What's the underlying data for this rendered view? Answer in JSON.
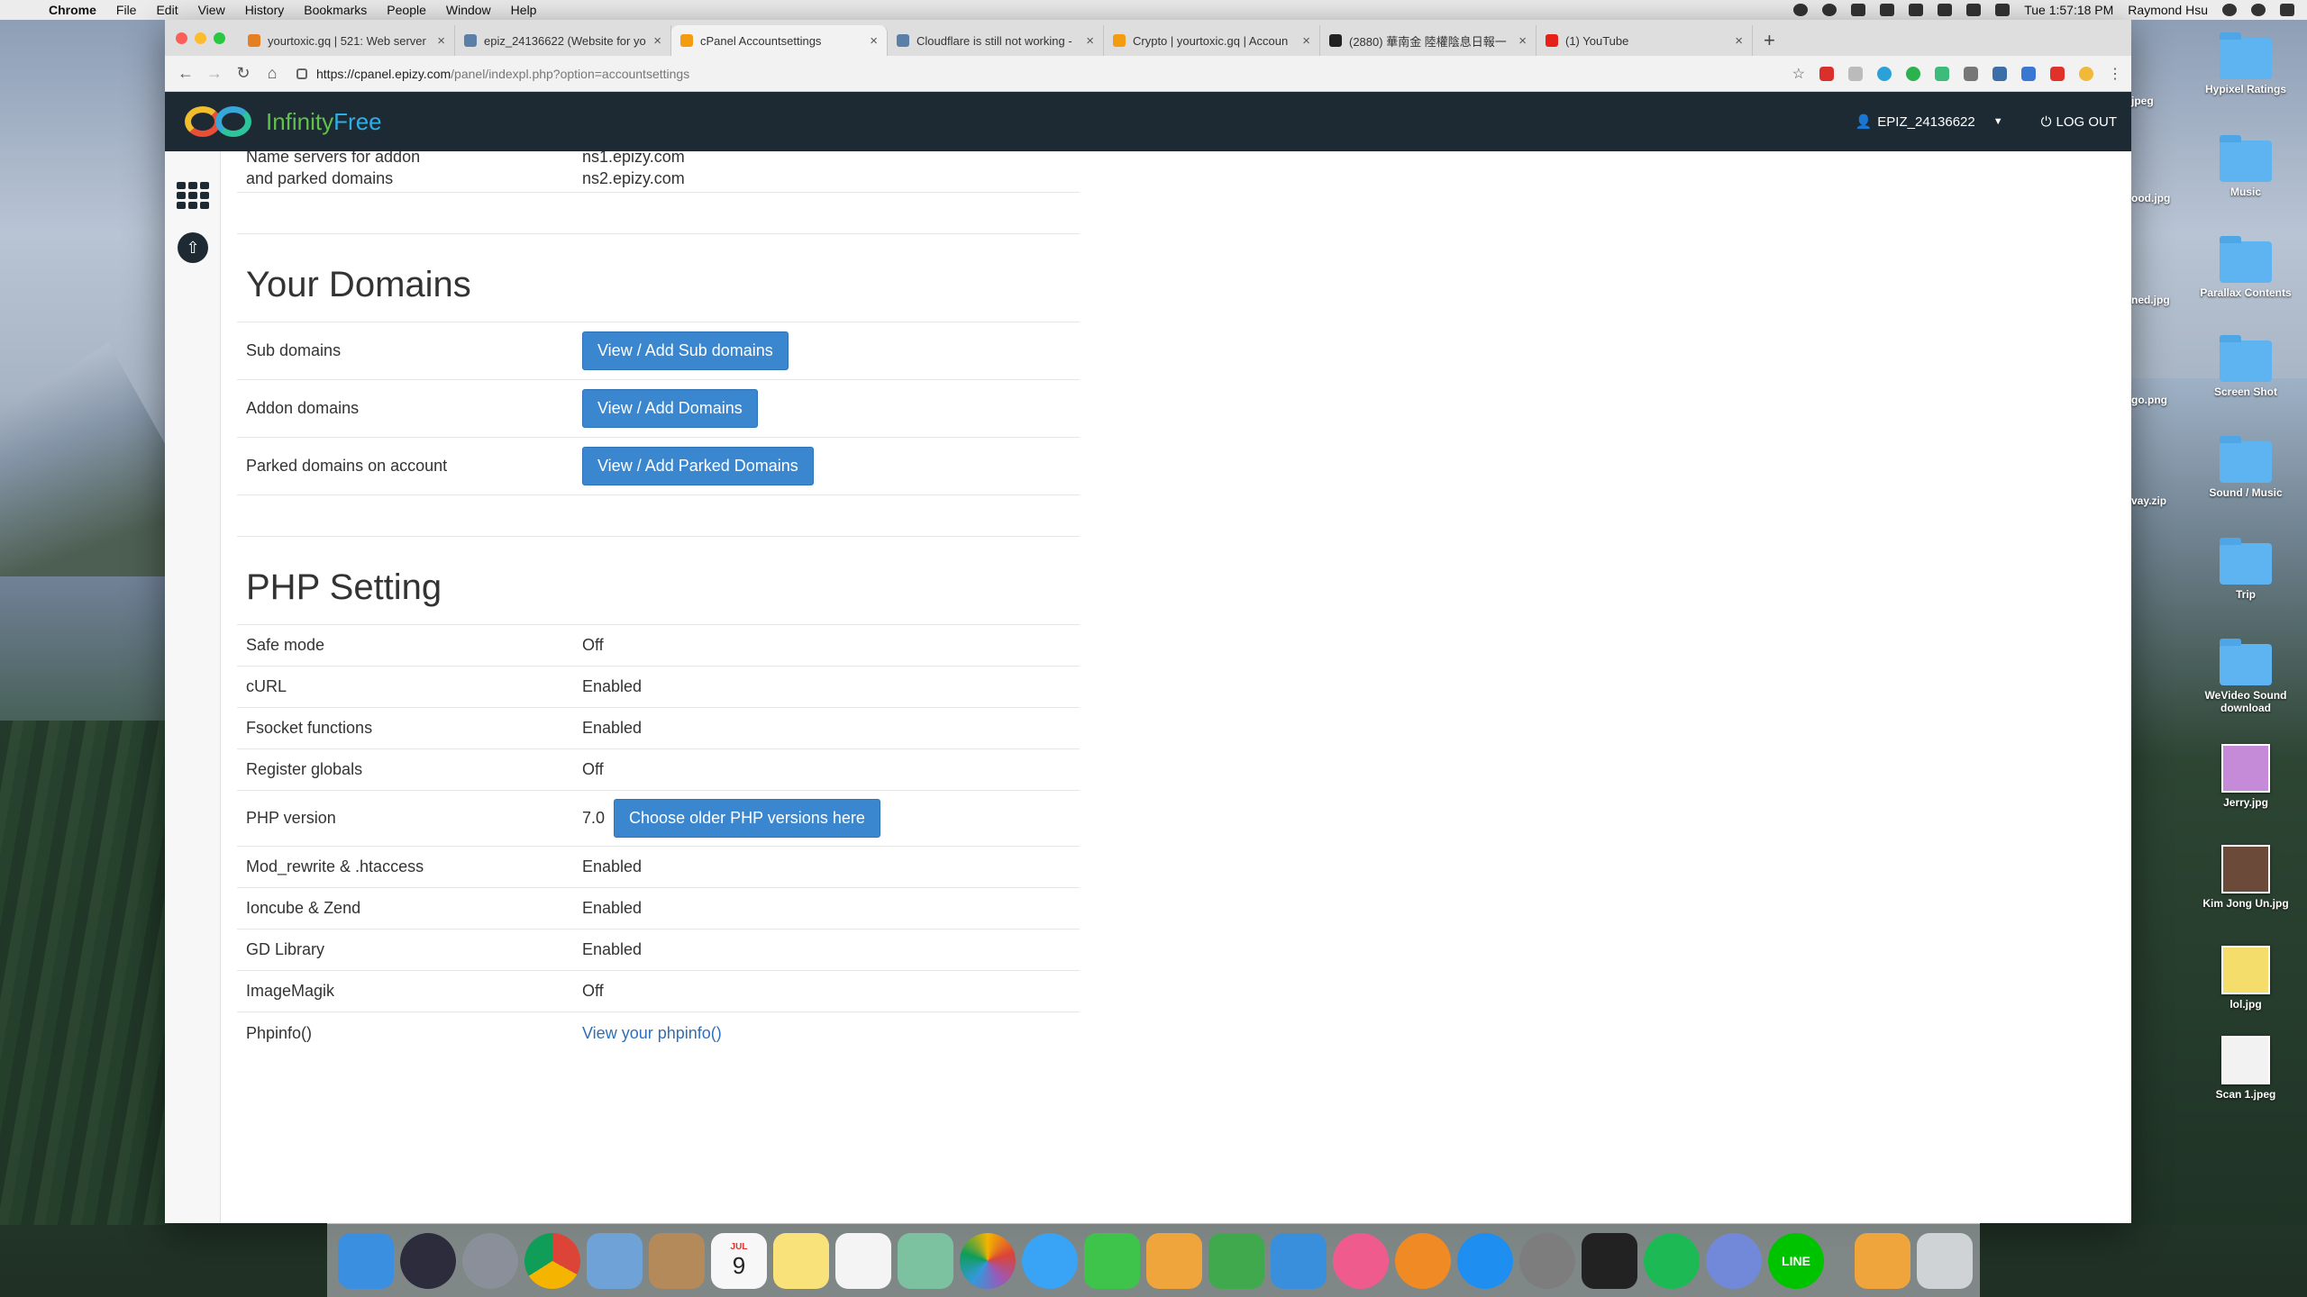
{
  "menubar": {
    "app": "Chrome",
    "menus": [
      "File",
      "Edit",
      "View",
      "History",
      "Bookmarks",
      "People",
      "Window",
      "Help"
    ],
    "clock": "Tue 1:57:18 PM",
    "user": "Raymond Hsu"
  },
  "browser": {
    "tabs": [
      {
        "title": "yourtoxic.gq | 521: Web server",
        "color": "#e67e22"
      },
      {
        "title": "epiz_24136622 (Website for yo",
        "color": "#5b7fa6"
      },
      {
        "title": "cPanel Accountsettings",
        "color": "#f39c12"
      },
      {
        "title": "Cloudflare is still not working -",
        "color": "#5b7fa6"
      },
      {
        "title": "Crypto | yourtoxic.gq | Accoun",
        "color": "#f39c12"
      },
      {
        "title": "(2880) 華南金 陸權陰息日報一",
        "color": "#222222"
      },
      {
        "title": "(1) YouTube",
        "color": "#e62117"
      }
    ],
    "url_host": "https://cpanel.epizy.com",
    "url_path": "/panel/indexpl.php?option=accountsettings"
  },
  "site": {
    "logo_a": "Infinity",
    "logo_b": "Free",
    "username": "EPIZ_24136622",
    "logout": "LOG OUT"
  },
  "content": {
    "nameservers": {
      "label_line1": "Name servers for addon",
      "label_line2": "and parked domains",
      "ns1": "ns1.epizy.com",
      "ns2": "ns2.epizy.com"
    },
    "domains": {
      "title": "Your Domains",
      "rows": [
        {
          "label": "Sub domains",
          "button": "View / Add Sub domains"
        },
        {
          "label": "Addon domains",
          "button": "View / Add Domains"
        },
        {
          "label": "Parked domains on account",
          "button": "View / Add Parked Domains"
        }
      ]
    },
    "php": {
      "title": "PHP Setting",
      "safe_mode": {
        "label": "Safe mode",
        "value": "Off"
      },
      "curl": {
        "label": "cURL",
        "value": "Enabled"
      },
      "fsocket": {
        "label": "Fsocket functions",
        "value": "Enabled"
      },
      "register_globals": {
        "label": "Register globals",
        "value": "Off"
      },
      "php_version": {
        "label": "PHP version",
        "value": "7.0",
        "button": "Choose older PHP versions here"
      },
      "mod_rewrite": {
        "label": "Mod_rewrite & .htaccess",
        "value": "Enabled"
      },
      "ioncube": {
        "label": "Ioncube & Zend",
        "value": "Enabled"
      },
      "gd": {
        "label": "GD Library",
        "value": "Enabled"
      },
      "imagemagik": {
        "label": "ImageMagik",
        "value": "Off"
      },
      "phpinfo": {
        "label": "Phpinfo()",
        "link": "View your phpinfo()"
      }
    }
  },
  "desktop": {
    "folders": [
      "Hypixel Ratings",
      "Music",
      "Parallax Contents",
      "Screen Shot",
      "Sound / Music",
      "Trip",
      "WeVideo Sound download"
    ],
    "files": [
      "Jerry.jpg",
      "Kim Jong Un.jpg",
      "lol.jpg",
      "Scan 1.jpeg"
    ],
    "partials": [
      "jpeg",
      "ood.jpg",
      "ned.jpg",
      "go.png",
      "vay.zip"
    ]
  },
  "dock": {
    "apps": [
      {
        "name": "Finder",
        "color": "#3b8fe0"
      },
      {
        "name": "Siri",
        "color": "#2c2c3c"
      },
      {
        "name": "Launchpad",
        "color": "#8a8f99"
      },
      {
        "name": "Chrome",
        "color": "#e8e8e8"
      },
      {
        "name": "Preview",
        "color": "#6fa2d6"
      },
      {
        "name": "Contacts",
        "color": "#b48a5a"
      },
      {
        "name": "Calendar",
        "color": "#f7f7f7"
      },
      {
        "name": "Notes",
        "color": "#f9e27a"
      },
      {
        "name": "Reminders",
        "color": "#f4f4f4"
      },
      {
        "name": "Maps",
        "color": "#7cc2a0"
      },
      {
        "name": "Photos",
        "color": "#f3f3f3"
      },
      {
        "name": "Messages",
        "color": "#39a3f5"
      },
      {
        "name": "FaceTime",
        "color": "#3ec34b"
      },
      {
        "name": "Pages",
        "color": "#f0a53c"
      },
      {
        "name": "Numbers",
        "color": "#40a94d"
      },
      {
        "name": "Keynote",
        "color": "#3a8fdc"
      },
      {
        "name": "iTunes",
        "color": "#f05b8d"
      },
      {
        "name": "Books",
        "color": "#f08a24"
      },
      {
        "name": "App Store",
        "color": "#1f8ef1"
      },
      {
        "name": "System Preferences",
        "color": "#7d7d7d"
      },
      {
        "name": "Activity Monitor",
        "color": "#222222"
      },
      {
        "name": "Spotify",
        "color": "#1db954"
      },
      {
        "name": "Discord",
        "color": "#7289da"
      },
      {
        "name": "LINE",
        "color": "#00c300"
      }
    ],
    "line_label": "LINE",
    "calendar_day": "9",
    "calendar_month": "JUL"
  }
}
